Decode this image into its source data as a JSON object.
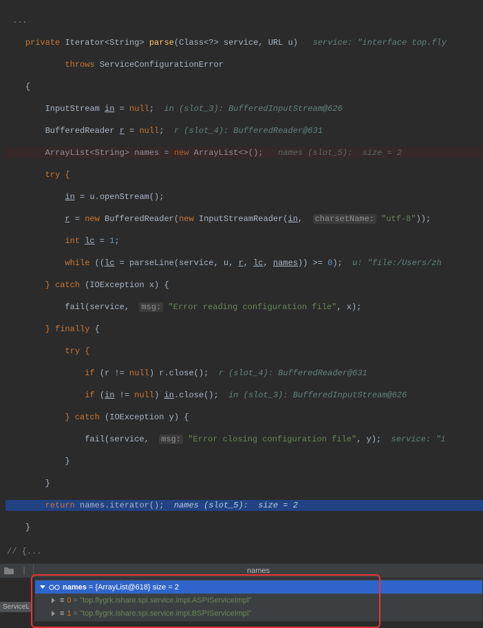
{
  "code": {
    "l1_kw1": "private",
    "l1_type": "Iterator<String>",
    "l1_m": "parse",
    "l1_args": "(Class<?> service, URL u)",
    "l1_hint": "service: \"interface top.fly",
    "l2_kw": "throws",
    "l2_type": "ServiceConfigurationError",
    "l4_a": "InputStream ",
    "l4_v": "in",
    "l4_b": " = ",
    "l4_kw": "null",
    "l4_c": ";",
    "l4_hint": "in (slot_3): BufferedInputStream@626",
    "l5_a": "BufferedReader ",
    "l5_v": "r",
    "l5_b": " = ",
    "l5_kw": "null",
    "l5_c": ";",
    "l5_hint": "r (slot_4): BufferedReader@631",
    "l6_a": "ArrayList<String> names = ",
    "l6_kw": "new",
    "l6_b": " ArrayList<>();",
    "l6_hint": "names (slot_5):  size = 2",
    "l7": "try {",
    "l8_v": "in",
    "l8_a": " = u.openStream();",
    "l9_v": "r",
    "l9_a": " = ",
    "l9_kw": "new",
    "l9_b": " BufferedReader(",
    "l9_kw2": "new",
    "l9_c": " InputStreamReader(",
    "l9_v2": "in",
    "l9_d": ", ",
    "l9_param": "charsetName:",
    "l9_str": "\"utf-8\"",
    "l9_e": "));",
    "l10_kw": "int",
    "l10_a": " ",
    "l10_v": "lc",
    "l10_b": " = ",
    "l10_n": "1",
    "l10_c": ";",
    "l11_kw": "while",
    "l11_a": " ((",
    "l11_v": "lc",
    "l11_b": " = parseLine(service, u, ",
    "l11_v2": "r",
    "l11_c": ", ",
    "l11_v3": "lc",
    "l11_d": ", ",
    "l11_v4": "names",
    "l11_e": ")) >= ",
    "l11_n": "0",
    "l11_f": ");",
    "l11_hint": "u: \"file:/Users/zh",
    "l12_kw": "} catch",
    "l12_a": " (IOException x) {",
    "l13_a": "fail(service, ",
    "l13_param": "msg:",
    "l13_str": "\"Error reading configuration file\"",
    "l13_b": ", x);",
    "l14_kw": "} finally",
    "l14_a": " {",
    "l15": "try {",
    "l16_kw": "if",
    "l16_a": " (r != ",
    "l16_kw2": "null",
    "l16_b": ") r.close();",
    "l16_hint": "r (slot_4): BufferedReader@631",
    "l17_kw": "if",
    "l17_a": " (",
    "l17_v": "in",
    "l17_b": " != ",
    "l17_kw2": "null",
    "l17_c": ") ",
    "l17_v2": "in",
    "l17_d": ".close();",
    "l17_hint": "in (slot_3): BufferedInputStream@626",
    "l18_kw": "} catch",
    "l18_a": " (IOException y) {",
    "l19_a": "fail(service, ",
    "l19_param": "msg:",
    "l19_str": "\"Error closing configuration file\"",
    "l19_b": ", y);",
    "l19_hint": "service: \"i",
    "l20": "}",
    "l21": "}",
    "l22_kw": "return",
    "l22_a": " names.iterator();",
    "l22_hint": "names (slot_5):  size = 2",
    "l23": "}"
  },
  "divider": {
    "col_label": "names",
    "pre": "// {..."
  },
  "sidebar": {
    "label": "ServiceL"
  },
  "debug": {
    "root_name": "names",
    "root_val": "= {ArrayList@618}  size = 2",
    "items": [
      {
        "idx": "0",
        "val": "\"top.flygrk.ishare.spi.service.impl.ASPIServiceImpl\""
      },
      {
        "idx": "1",
        "val": "\"top.flygrk.ishare.spi.service.impl.BSPIServiceImpl\""
      }
    ]
  }
}
